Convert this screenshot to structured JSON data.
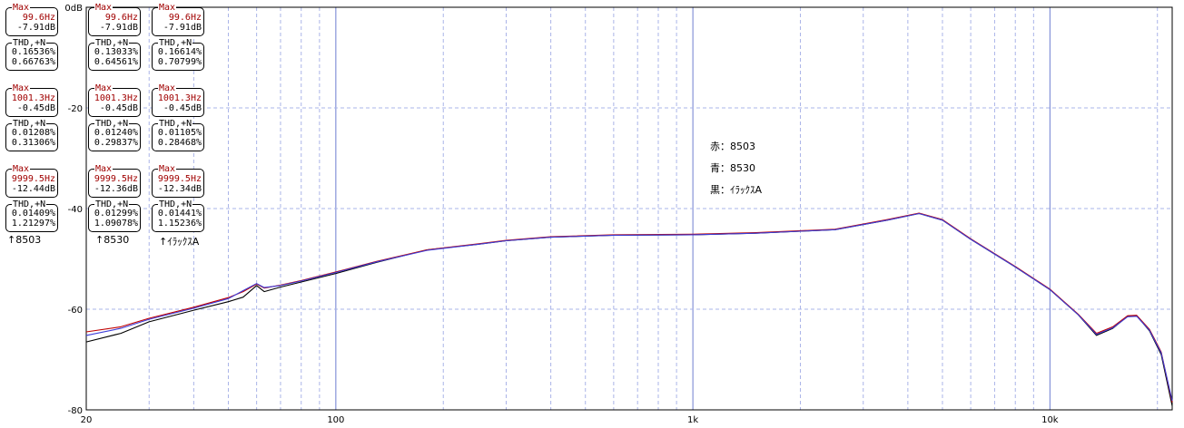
{
  "readouts": [
    {
      "caption": "↑8503",
      "groups": [
        {
          "max_label": "Max",
          "freq": "99.6Hz",
          "level": "-7.91dB",
          "thd_label": "THD,+N",
          "thd1": "0.16536%",
          "thd2": "0.66763%"
        },
        {
          "max_label": "Max",
          "freq": "1001.3Hz",
          "level": "-0.45dB",
          "thd_label": "THD,+N",
          "thd1": "0.01208%",
          "thd2": "0.31306%"
        },
        {
          "max_label": "Max",
          "freq": "9999.5Hz",
          "level": "-12.44dB",
          "thd_label": "THD,+N",
          "thd1": "0.01409%",
          "thd2": "1.21297%"
        }
      ]
    },
    {
      "caption": "↑8530",
      "groups": [
        {
          "max_label": "Max",
          "freq": "99.6Hz",
          "level": "-7.91dB",
          "thd_label": "THD,+N",
          "thd1": "0.13033%",
          "thd2": "0.64561%"
        },
        {
          "max_label": "Max",
          "freq": "1001.3Hz",
          "level": "-0.45dB",
          "thd_label": "THD,+N",
          "thd1": "0.01240%",
          "thd2": "0.29837%"
        },
        {
          "max_label": "Max",
          "freq": "9999.5Hz",
          "level": "-12.36dB",
          "thd_label": "THD,+N",
          "thd1": "0.01299%",
          "thd2": "1.09078%"
        }
      ]
    },
    {
      "caption": "↑ｲﾗｯｸｽA",
      "groups": [
        {
          "max_label": "Max",
          "freq": "99.6Hz",
          "level": "-7.91dB",
          "thd_label": "THD,+N",
          "thd1": "0.16614%",
          "thd2": "0.70799%"
        },
        {
          "max_label": "Max",
          "freq": "1001.3Hz",
          "level": "-0.45dB",
          "thd_label": "THD,+N",
          "thd1": "0.01105%",
          "thd2": "0.28468%"
        },
        {
          "max_label": "Max",
          "freq": "9999.5Hz",
          "level": "-12.34dB",
          "thd_label": "THD,+N",
          "thd1": "0.01441%",
          "thd2": "1.15236%"
        }
      ]
    }
  ],
  "legend": [
    "赤：8503",
    "青：8530",
    "黒：ｲﾗｯｸｽA"
  ],
  "chart_data": {
    "type": "line",
    "xscale": "log",
    "xlim": [
      20,
      22000
    ],
    "ylim": [
      -80,
      0
    ],
    "ylabels": [
      "0dB",
      "-20",
      "-40",
      "-60",
      "-80"
    ],
    "yticks": [
      0,
      -20,
      -40,
      -60,
      -80
    ],
    "xlabels": [
      "20",
      "100",
      "1k",
      "10k"
    ],
    "xticks": [
      20,
      100,
      1000,
      10000
    ],
    "grid": true,
    "colors": {
      "red": "#c00000",
      "blue": "#3c3cd8",
      "black": "#000000",
      "grid": "#aab4e8",
      "grid_dark": "#6e7ed0"
    },
    "series": [
      {
        "name": "8503",
        "color": "#c00000",
        "points": [
          [
            20,
            -64.5
          ],
          [
            25,
            -63.5
          ],
          [
            30,
            -61.8
          ],
          [
            40,
            -59.6
          ],
          [
            50,
            -57.7
          ],
          [
            55,
            -56.5
          ],
          [
            60,
            -55
          ],
          [
            63,
            -55.8
          ],
          [
            70,
            -55.2
          ],
          [
            80,
            -54.3
          ],
          [
            100,
            -52.6
          ],
          [
            130,
            -50.5
          ],
          [
            180,
            -48.2
          ],
          [
            250,
            -47
          ],
          [
            300,
            -46.3
          ],
          [
            400,
            -45.6
          ],
          [
            600,
            -45.2
          ],
          [
            1000,
            -45.1
          ],
          [
            1500,
            -44.8
          ],
          [
            2500,
            -44.1
          ],
          [
            3500,
            -42.2
          ],
          [
            4300,
            -40.9
          ],
          [
            5000,
            -42.2
          ],
          [
            6000,
            -46
          ],
          [
            8000,
            -51.5
          ],
          [
            10000,
            -56
          ],
          [
            12000,
            -61
          ],
          [
            13500,
            -64.8
          ],
          [
            15000,
            -63.5
          ],
          [
            16500,
            -61.3
          ],
          [
            17500,
            -61.2
          ],
          [
            19000,
            -64
          ],
          [
            20500,
            -68.5
          ],
          [
            22000,
            -78.5
          ]
        ]
      },
      {
        "name": "8530",
        "color": "#3c3cd8",
        "points": [
          [
            20,
            -65.2
          ],
          [
            25,
            -63.8
          ],
          [
            30,
            -62
          ],
          [
            40,
            -59.8
          ],
          [
            50,
            -57.9
          ],
          [
            55,
            -56.3
          ],
          [
            60,
            -54.9
          ],
          [
            63,
            -55.7
          ],
          [
            70,
            -55.3
          ],
          [
            80,
            -54.4
          ],
          [
            100,
            -52.7
          ],
          [
            130,
            -50.6
          ],
          [
            180,
            -48.3
          ],
          [
            250,
            -47.1
          ],
          [
            300,
            -46.4
          ],
          [
            400,
            -45.7
          ],
          [
            600,
            -45.3
          ],
          [
            1000,
            -45.2
          ],
          [
            1500,
            -44.9
          ],
          [
            2500,
            -44.2
          ],
          [
            3500,
            -42.3
          ],
          [
            4300,
            -41
          ],
          [
            5000,
            -42.3
          ],
          [
            6000,
            -46.1
          ],
          [
            8000,
            -51.6
          ],
          [
            10000,
            -56.1
          ],
          [
            12000,
            -61.1
          ],
          [
            13500,
            -65
          ],
          [
            15000,
            -63.7
          ],
          [
            16500,
            -61.5
          ],
          [
            17500,
            -61.4
          ],
          [
            19000,
            -64.2
          ],
          [
            20500,
            -68.7
          ],
          [
            22000,
            -78.2
          ]
        ]
      },
      {
        "name": "ｲﾗｯｸｽA",
        "color": "#000000",
        "points": [
          [
            20,
            -66.5
          ],
          [
            25,
            -64.8
          ],
          [
            30,
            -62.5
          ],
          [
            40,
            -60.2
          ],
          [
            50,
            -58.5
          ],
          [
            55,
            -57.6
          ],
          [
            60,
            -55.3
          ],
          [
            63,
            -56.5
          ],
          [
            70,
            -55.6
          ],
          [
            80,
            -54.6
          ],
          [
            100,
            -52.9
          ],
          [
            130,
            -50.7
          ],
          [
            180,
            -48.2
          ],
          [
            250,
            -47.1
          ],
          [
            300,
            -46.4
          ],
          [
            400,
            -45.7
          ],
          [
            600,
            -45.3
          ],
          [
            1000,
            -45.2
          ],
          [
            1500,
            -44.9
          ],
          [
            2500,
            -44.2
          ],
          [
            3500,
            -42.3
          ],
          [
            4300,
            -41
          ],
          [
            5000,
            -42.3
          ],
          [
            6000,
            -46.1
          ],
          [
            8000,
            -51.6
          ],
          [
            10000,
            -56.1
          ],
          [
            12000,
            -61.1
          ],
          [
            13500,
            -65.2
          ],
          [
            15000,
            -63.8
          ],
          [
            16500,
            -61.4
          ],
          [
            17500,
            -61.3
          ],
          [
            19000,
            -64.3
          ],
          [
            20500,
            -69
          ],
          [
            22000,
            -79.2
          ]
        ]
      }
    ]
  }
}
